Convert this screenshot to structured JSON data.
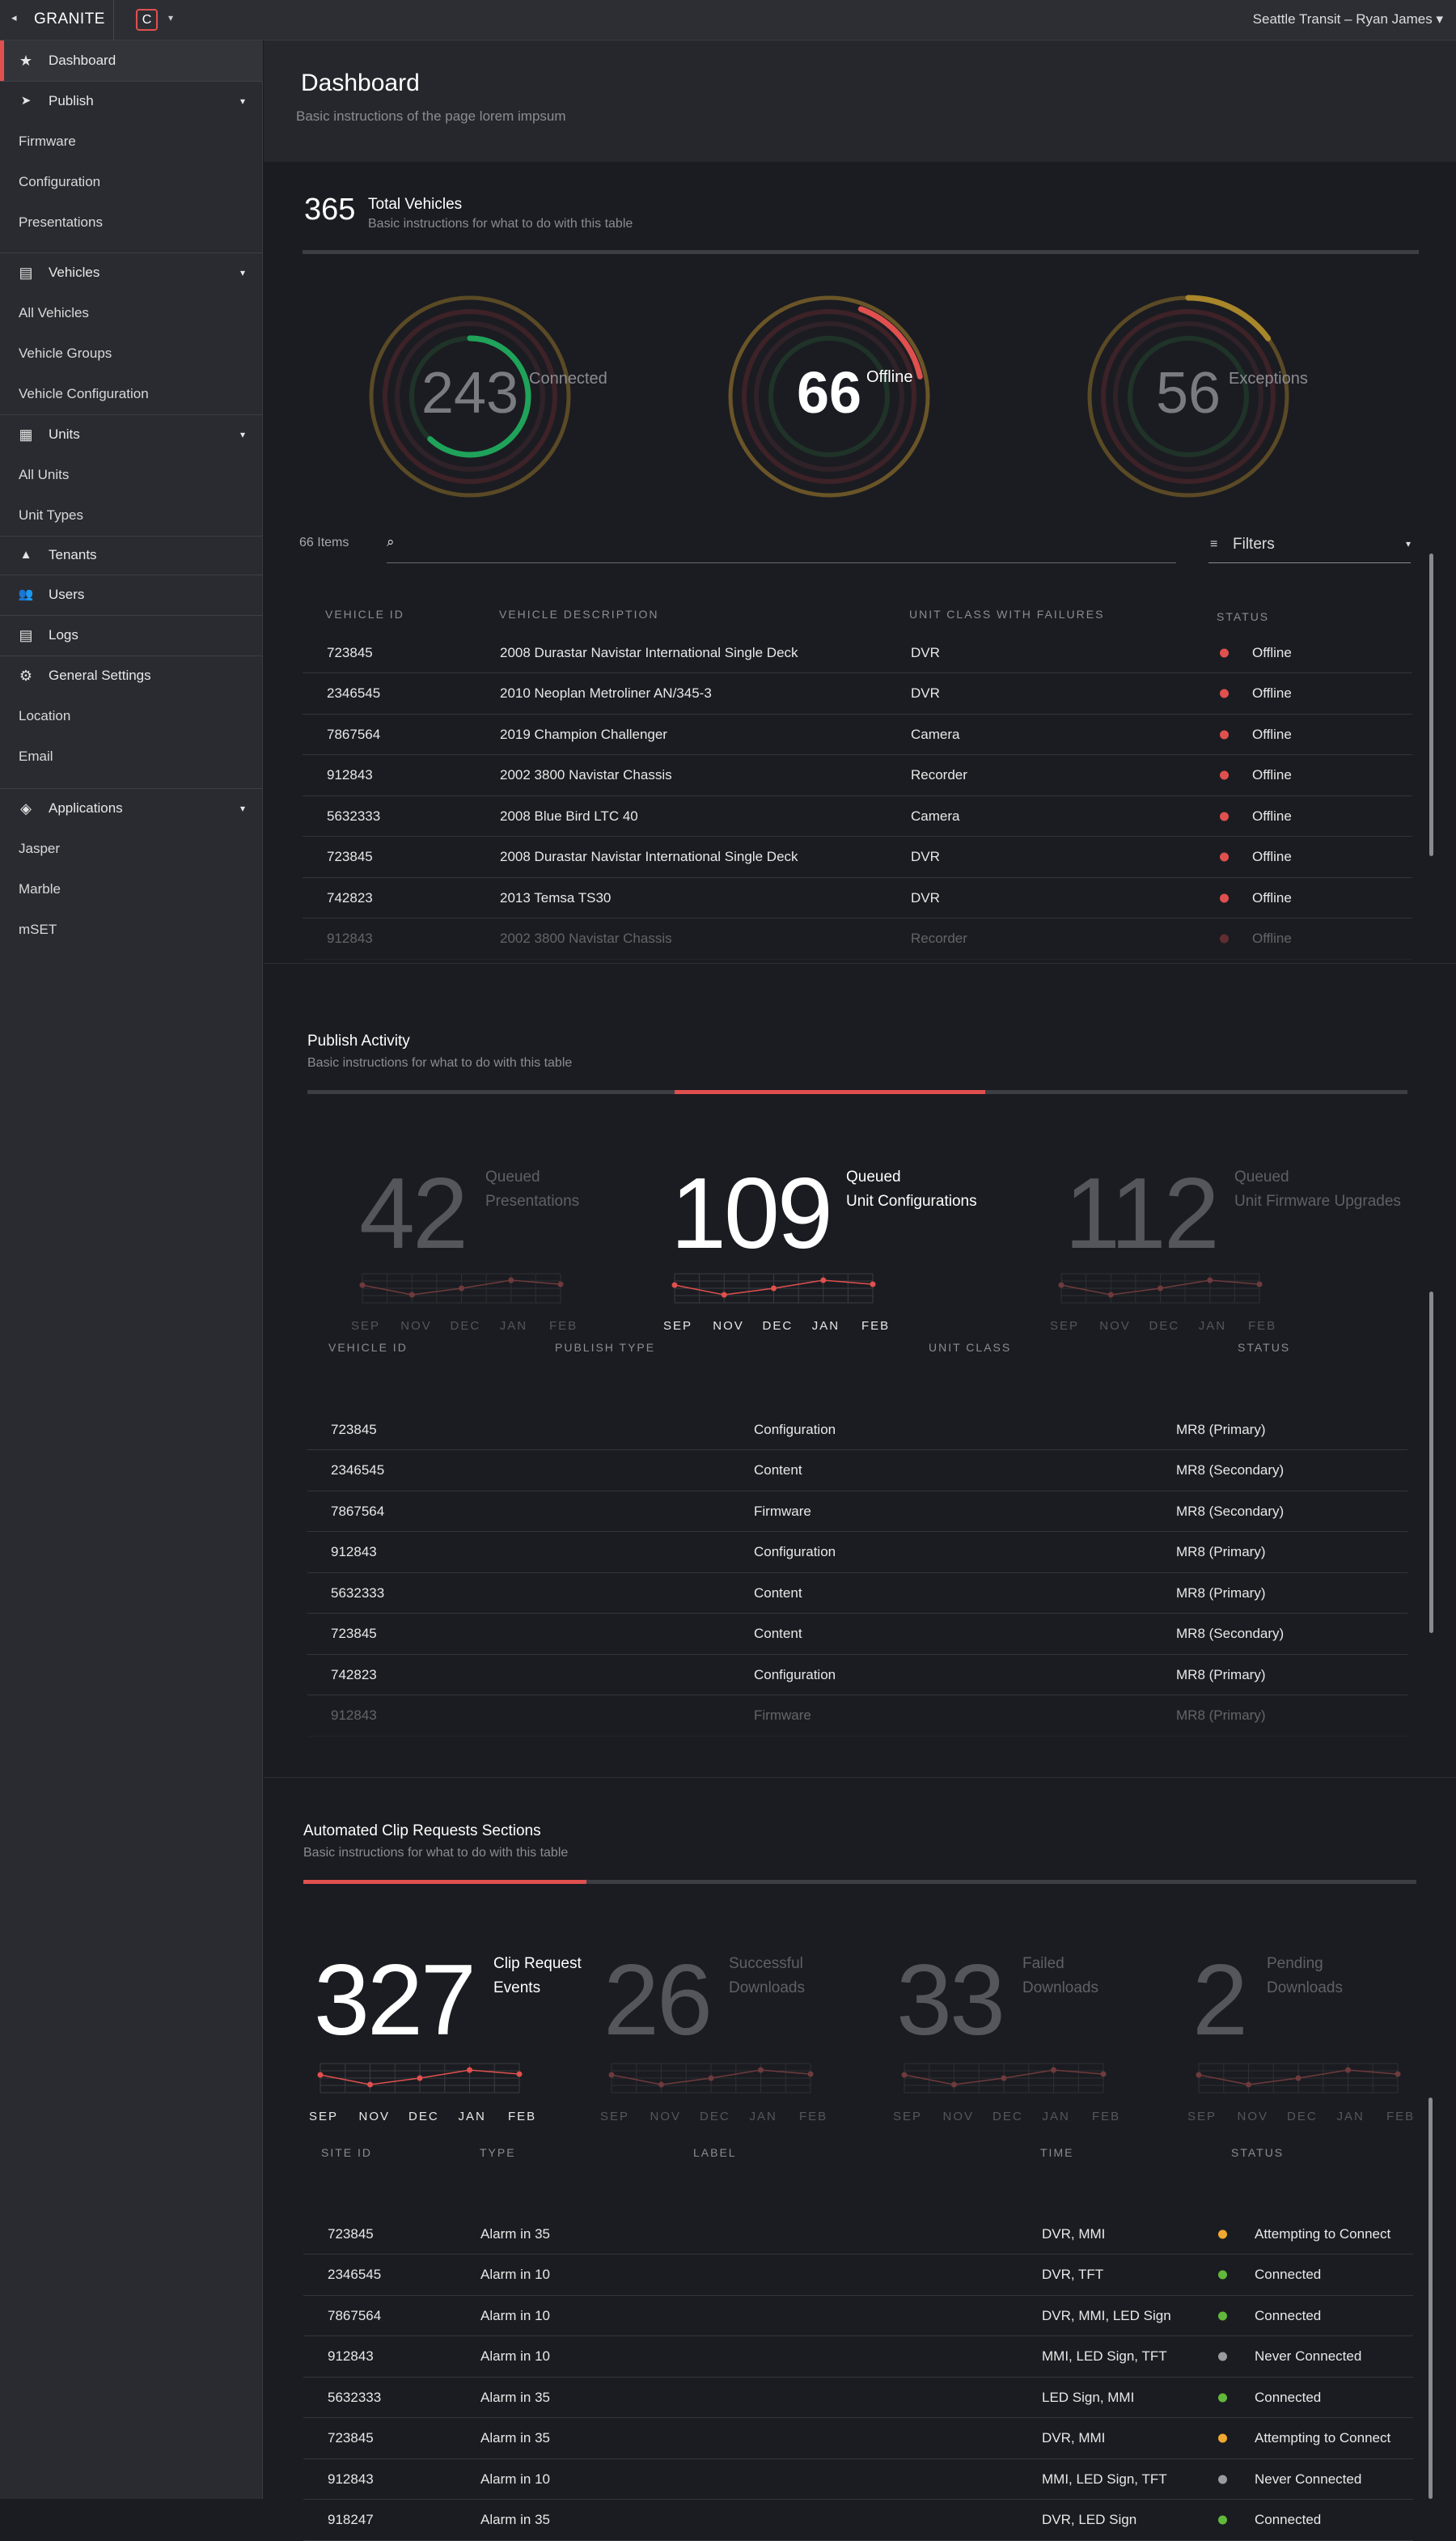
{
  "topbar": {
    "back_glyph": "◂",
    "brand": "GRANITE",
    "logo_letter": "C",
    "logo_caret": "▾",
    "user": "Seattle Transit – Ryan James",
    "user_caret": "▾"
  },
  "sidebar": {
    "items": [
      {
        "label": "Dashboard",
        "icon": "star-icon",
        "glyph": "★"
      },
      {
        "label": "Publish",
        "icon": "paper-plane-icon",
        "glyph": "➤"
      },
      {
        "label": "Firmware"
      },
      {
        "label": "Configuration"
      },
      {
        "label": "Presentations"
      },
      {
        "label": "Vehicles",
        "icon": "bus-icon",
        "glyph": "▤"
      },
      {
        "label": "All Vehicles"
      },
      {
        "label": "Vehicle Groups"
      },
      {
        "label": "Vehicle Configuration"
      },
      {
        "label": "Units",
        "icon": "units-icon",
        "glyph": "▦"
      },
      {
        "label": "All Units"
      },
      {
        "label": "Unit Types"
      },
      {
        "label": "Tenants",
        "icon": "tent-icon",
        "glyph": "▲"
      },
      {
        "label": "Users",
        "icon": "users-icon",
        "glyph": "👥"
      },
      {
        "label": "Logs",
        "icon": "logs-icon",
        "glyph": "▤"
      },
      {
        "label": "General Settings",
        "icon": "gear-icon",
        "glyph": "⚙"
      },
      {
        "label": "Location"
      },
      {
        "label": "Email"
      },
      {
        "label": "Applications",
        "icon": "layers-icon",
        "glyph": "◈"
      },
      {
        "label": "Jasper"
      },
      {
        "label": "Marble"
      },
      {
        "label": "mSET"
      }
    ],
    "caret": "▾"
  },
  "page": {
    "title": "Dashboard",
    "subtitle": "Basic instructions of the page lorem impsum"
  },
  "vehicles": {
    "total": "365",
    "title": "Total Vehicles",
    "subtitle": "Basic instructions for what to do with this table",
    "rings": [
      {
        "value": "243",
        "label": "Connected"
      },
      {
        "value": "66",
        "label": "Offline"
      },
      {
        "value": "56",
        "label": "Exceptions"
      }
    ],
    "items_count": "66 Items",
    "search_icon": "⌕",
    "filters": {
      "icon": "≡",
      "label": "Filters",
      "caret": "▾"
    },
    "headers": [
      "VEHICLE ID",
      "VEHICLE DESCRIPTION",
      "UNIT CLASS WITH FAILURES",
      "STATUS"
    ],
    "rows": [
      [
        "723845",
        "2008 Durastar Navistar International Single Deck",
        "DVR",
        "Offline"
      ],
      [
        "2346545",
        "2010 Neoplan Metroliner AN/345-3",
        "DVR",
        "Offline"
      ],
      [
        "7867564",
        "2019 Champion Challenger",
        "Camera",
        "Offline"
      ],
      [
        "912843",
        "2002 3800 Navistar Chassis",
        "Recorder",
        "Offline"
      ],
      [
        "5632333",
        "2008 Blue Bird LTC 40",
        "Camera",
        "Offline"
      ],
      [
        "723845",
        "2008 Durastar Navistar International Single Deck",
        "DVR",
        "Offline"
      ],
      [
        "742823",
        "2013 Temsa TS30",
        "DVR",
        "Offline"
      ],
      [
        "912843",
        "2002 3800 Navistar Chassis",
        "Recorder",
        "Offline"
      ]
    ],
    "status_color": "#e0504e"
  },
  "publish": {
    "title": "Publish Activity",
    "subtitle": "Basic instructions for what to do with this table",
    "stats": [
      {
        "value": "42",
        "label1": "Queued",
        "label2": "Presentations"
      },
      {
        "value": "109",
        "label1": "Queued",
        "label2": "Unit Configurations"
      },
      {
        "value": "112",
        "label1": "Queued",
        "label2": "Unit Firmware Upgrades"
      }
    ],
    "months": [
      "SEP",
      "NOV",
      "DEC",
      "JAN",
      "FEB"
    ],
    "headers": [
      "VEHICLE ID",
      "PUBLISH TYPE",
      "UNIT CLASS",
      "STATUS"
    ],
    "rows": [
      [
        "723845",
        "Configuration",
        "MR8 (Primary)"
      ],
      [
        "2346545",
        "Content",
        "MR8 (Secondary)"
      ],
      [
        "7867564",
        "Firmware",
        "MR8 (Secondary)"
      ],
      [
        "912843",
        "Configuration",
        "MR8 (Primary)"
      ],
      [
        "5632333",
        "Content",
        "MR8 (Primary)"
      ],
      [
        "723845",
        "Content",
        "MR8 (Secondary)"
      ],
      [
        "742823",
        "Configuration",
        "MR8 (Primary)"
      ],
      [
        "912843",
        "Firmware",
        "MR8 (Primary)"
      ]
    ]
  },
  "clips": {
    "title": "Automated Clip Requests Sections",
    "subtitle": "Basic instructions for what to do with this table",
    "stats": [
      {
        "value": "327",
        "label1": "Clip Request",
        "label2": "Events"
      },
      {
        "value": "26",
        "label1": "Successful",
        "label2": "Downloads"
      },
      {
        "value": "33",
        "label1": "Failed",
        "label2": "Downloads"
      },
      {
        "value": "2",
        "label1": "Pending",
        "label2": "Downloads"
      }
    ],
    "months": [
      "SEP",
      "NOV",
      "DEC",
      "JAN",
      "FEB"
    ],
    "headers": [
      "SITE ID",
      "TYPE",
      "LABEL",
      "TIME",
      "STATUS"
    ],
    "rows": [
      [
        "723845",
        "Alarm in 35",
        "",
        "DVR, MMI",
        "Attempting to Connect",
        "#f0a830"
      ],
      [
        "2346545",
        "Alarm in 10",
        "",
        "DVR, TFT",
        "Connected",
        "#62b83a"
      ],
      [
        "7867564",
        "Alarm in 10",
        "",
        "DVR, MMI, LED Sign",
        "Connected",
        "#62b83a"
      ],
      [
        "912843",
        "Alarm in 10",
        "",
        "MMI, LED Sign, TFT",
        "Never Connected",
        "#9a9b9f"
      ],
      [
        "5632333",
        "Alarm in 35",
        "",
        "LED Sign, MMI",
        "Connected",
        "#62b83a"
      ],
      [
        "723845",
        "Alarm in 35",
        "",
        "DVR, MMI",
        "Attempting to Connect",
        "#f0a830"
      ],
      [
        "912843",
        "Alarm in 10",
        "",
        "MMI, LED Sign, TFT",
        "Never Connected",
        "#9a9b9f"
      ],
      [
        "918247",
        "Alarm in 35",
        "",
        "DVR, LED Sign",
        "Connected",
        "#62b83a"
      ]
    ]
  },
  "colors": {
    "accent": "#e0504e",
    "connected": "#1fa35a",
    "exceptions": "#a8862a"
  }
}
